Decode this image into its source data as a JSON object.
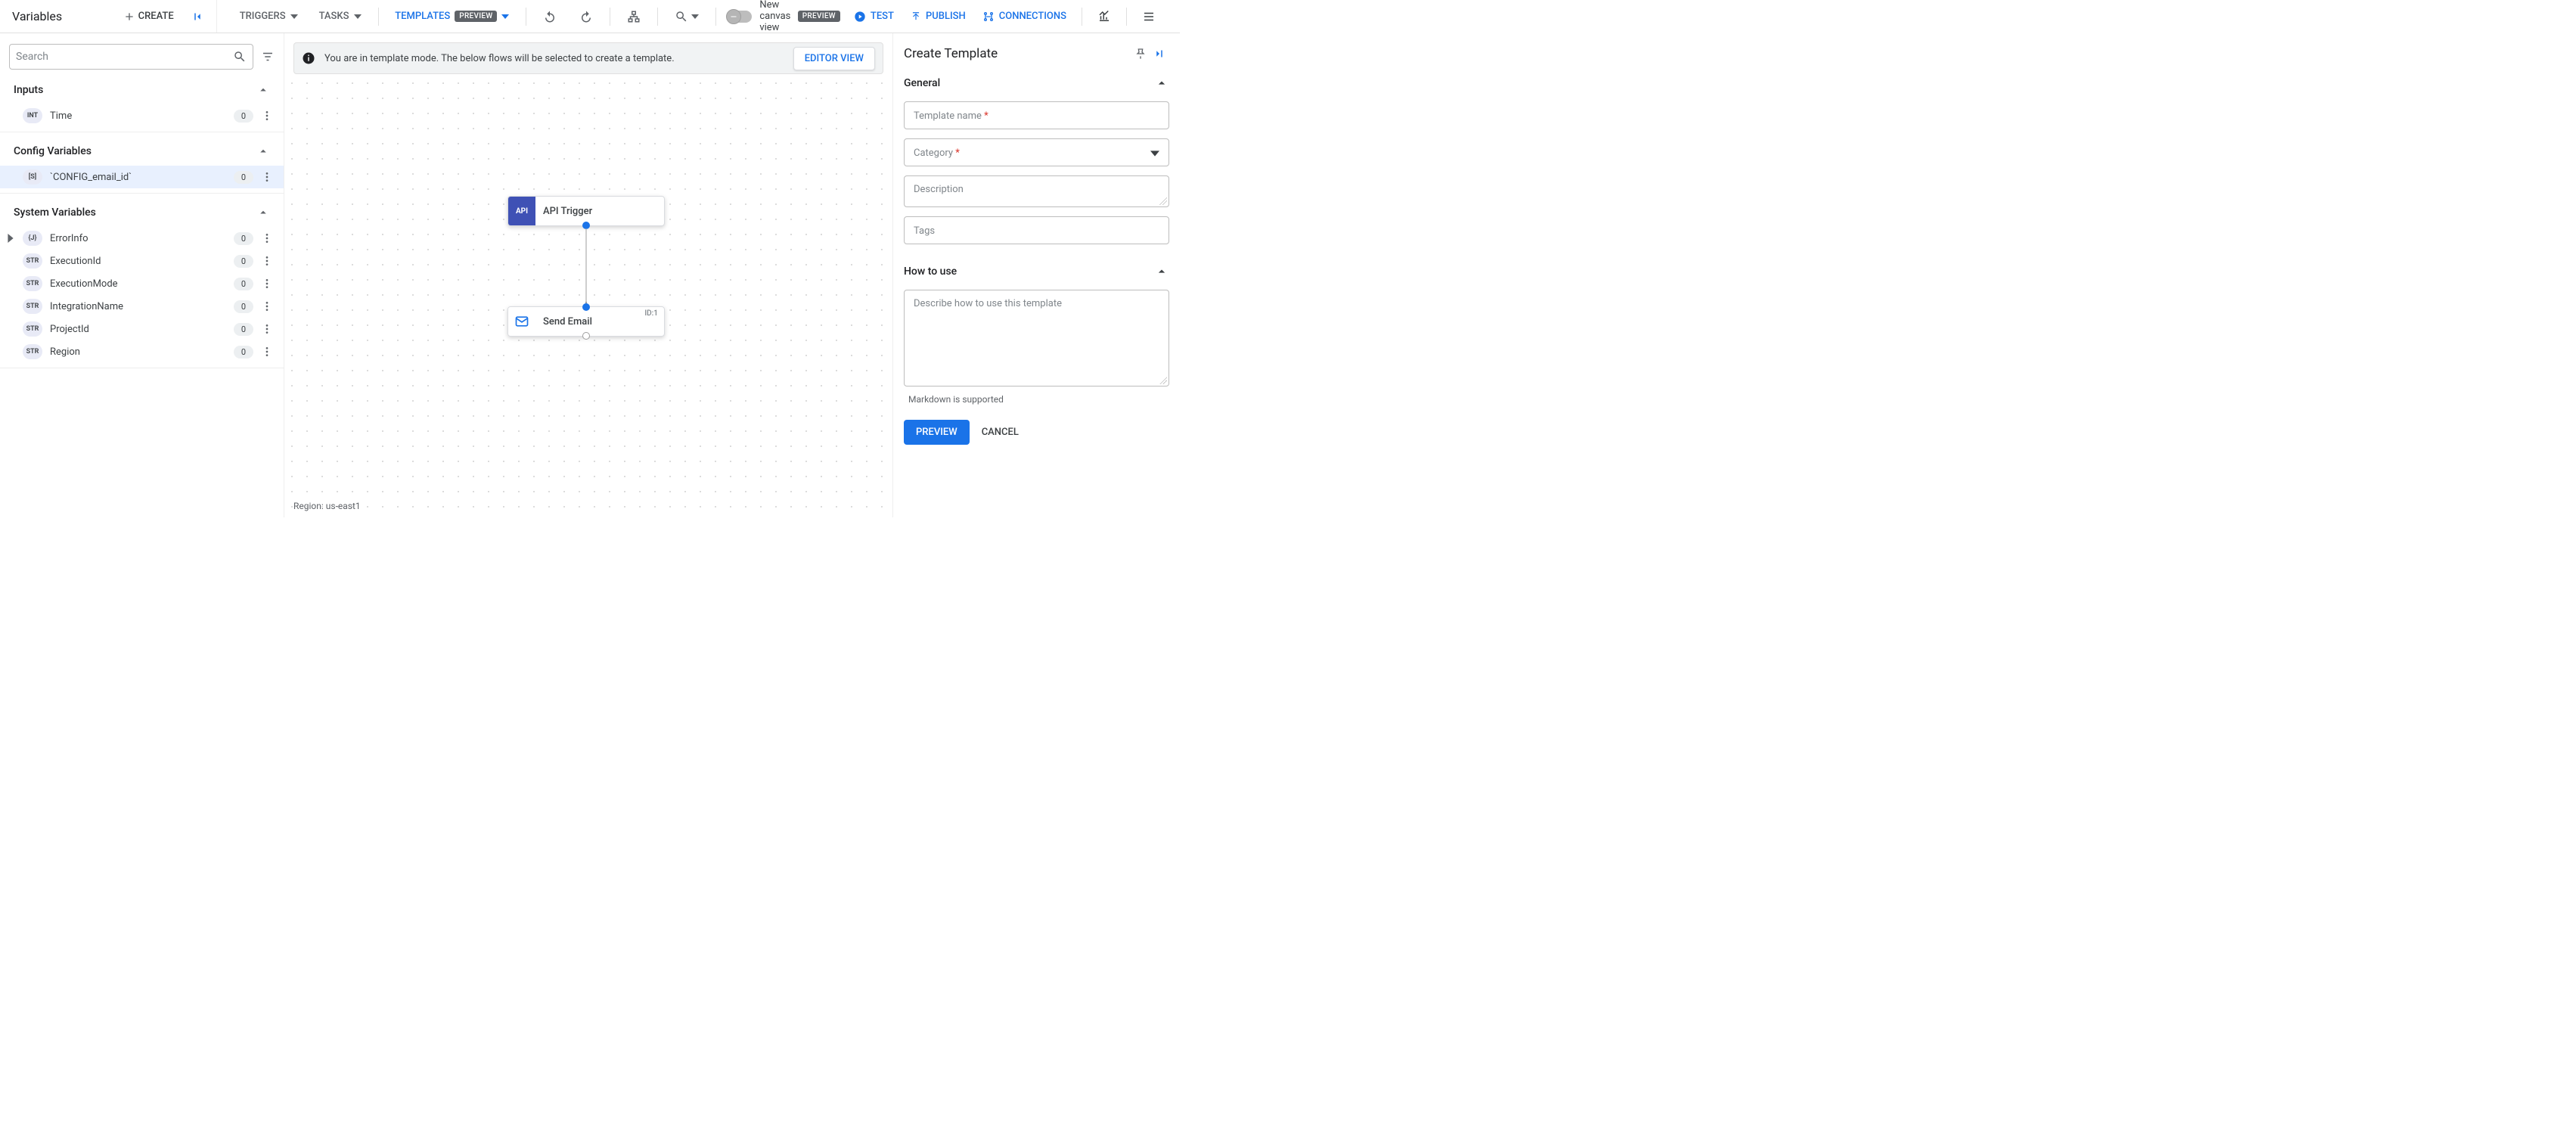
{
  "left_panel": {
    "title": "Variables",
    "create_label": "CREATE",
    "search_placeholder": "Search",
    "sections": {
      "inputs": {
        "title": "Inputs",
        "items": [
          {
            "type": "INT",
            "name": "Time",
            "count": "0"
          }
        ]
      },
      "config": {
        "title": "Config Variables",
        "items": [
          {
            "type": "[S]",
            "name": "`CONFIG_email_id`",
            "count": "0",
            "selected": true
          }
        ]
      },
      "system": {
        "title": "System Variables",
        "items": [
          {
            "type": "{J}",
            "name": "ErrorInfo",
            "count": "0",
            "expandable": true
          },
          {
            "type": "STR",
            "name": "ExecutionId",
            "count": "0"
          },
          {
            "type": "STR",
            "name": "ExecutionMode",
            "count": "0"
          },
          {
            "type": "STR",
            "name": "IntegrationName",
            "count": "0"
          },
          {
            "type": "STR",
            "name": "ProjectId",
            "count": "0"
          },
          {
            "type": "STR",
            "name": "Region",
            "count": "0"
          }
        ]
      }
    }
  },
  "toolbar": {
    "triggers": "TRIGGERS",
    "tasks": "TASKS",
    "templates": "TEMPLATES",
    "preview_badge": "PREVIEW",
    "new_canvas": "New canvas view",
    "test": "TEST",
    "publish": "PUBLISH",
    "connections": "CONNECTIONS"
  },
  "canvas": {
    "banner_text": "You are in template mode. The below flows will be selected to create a template.",
    "editor_view": "EDITOR VIEW",
    "node1": {
      "icon_text": "API",
      "label": "API Trigger"
    },
    "node2": {
      "label": "Send Email",
      "id": "ID:1"
    },
    "region": "Region: us-east1"
  },
  "right_panel": {
    "title": "Create Template",
    "general": "General",
    "template_name_label": "Template name ",
    "category_label": "Category ",
    "description_label": "Description",
    "tags_label": "Tags",
    "how_to_use": "How to use",
    "how_to_use_placeholder": "Describe how to use this template",
    "markdown_hint": "Markdown is supported",
    "preview": "PREVIEW",
    "cancel": "CANCEL",
    "asterisk": "*"
  }
}
